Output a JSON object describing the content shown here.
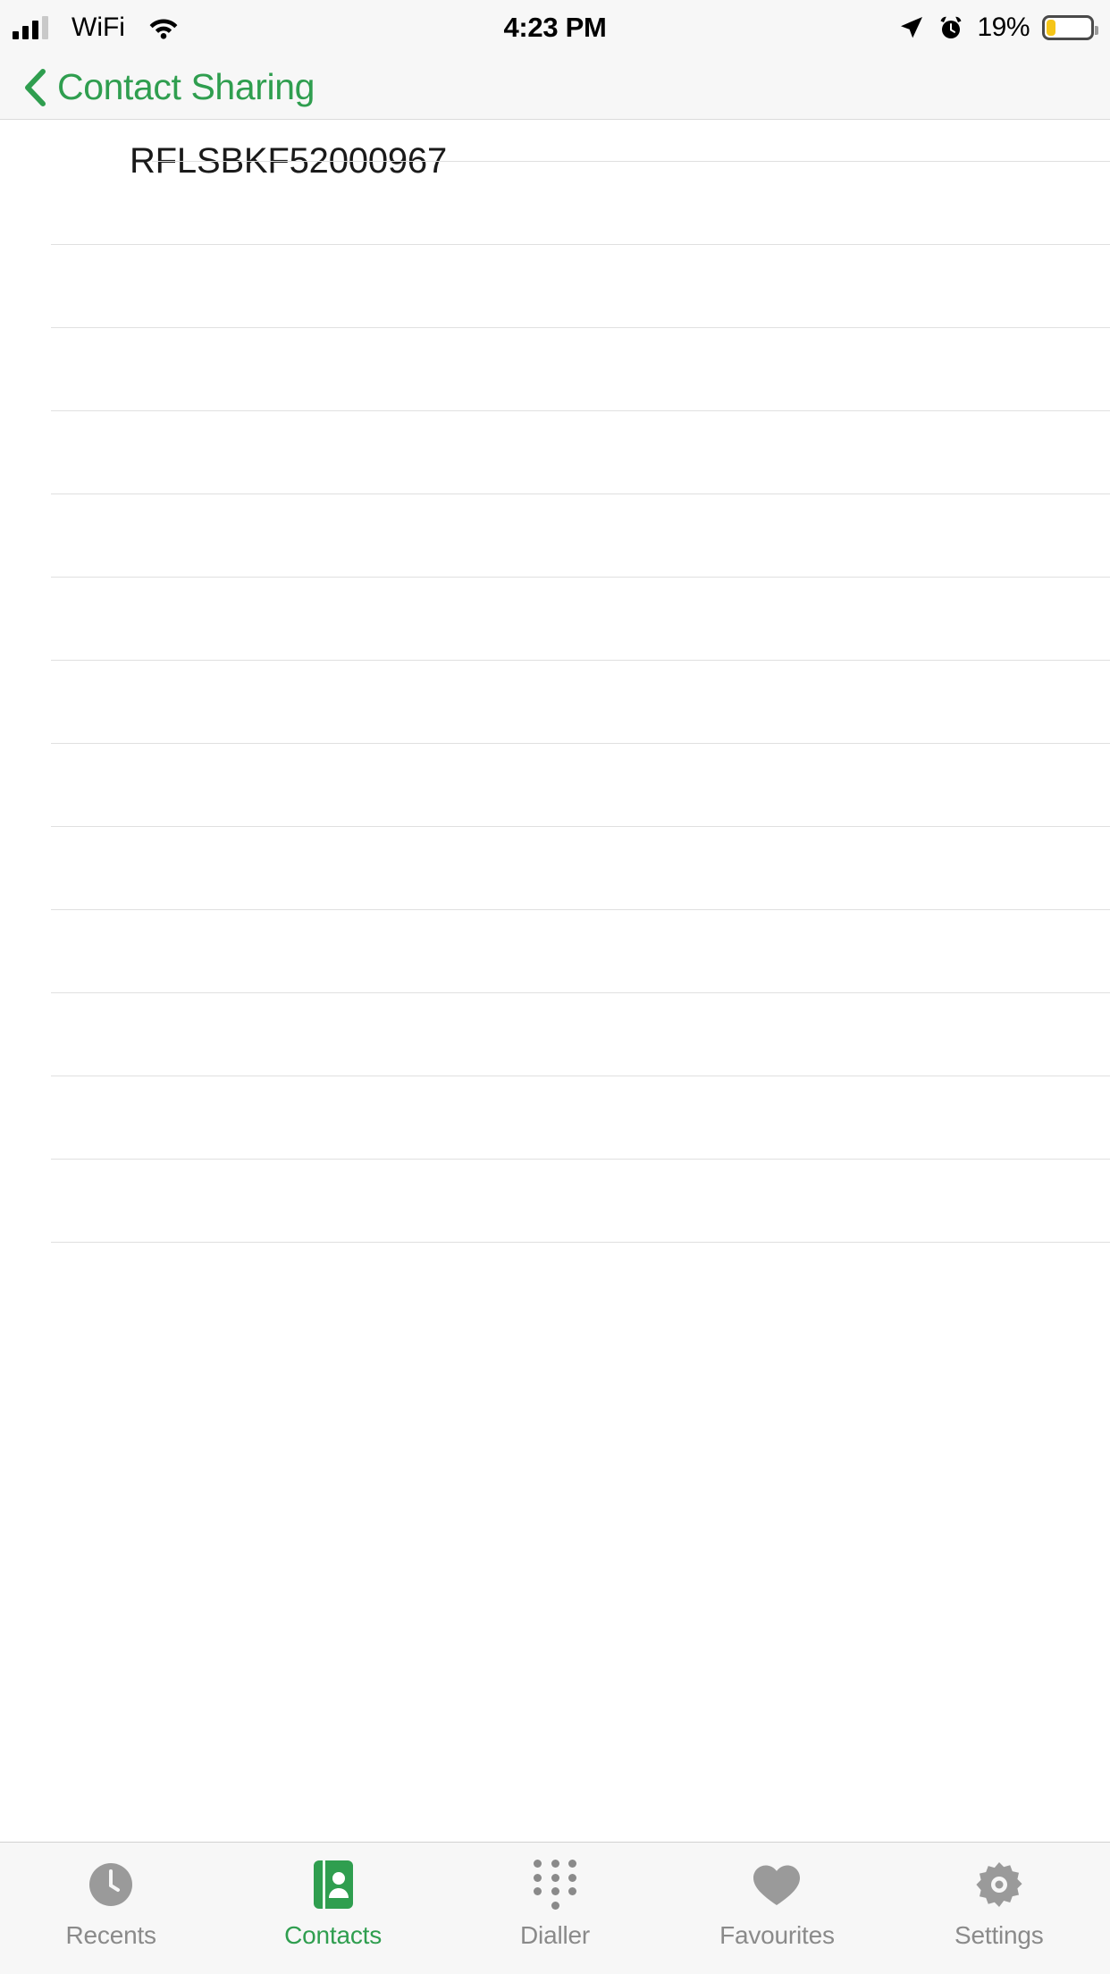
{
  "status_bar": {
    "signal_icon": "cellular-bars-icon",
    "signal_bars_filled": 3,
    "signal_bars_total": 4,
    "carrier": "WiFi",
    "wifi_icon": "wifi-icon",
    "time": "4:23 PM",
    "location_icon": "location-arrow-icon",
    "alarm_icon": "alarm-clock-icon",
    "battery_percent_label": "19%",
    "battery_level": 19,
    "battery_color": "#f5c518"
  },
  "nav_bar": {
    "back_icon": "chevron-left-icon",
    "back_title": "Contact Sharing",
    "tint_color": "#2f9e4f"
  },
  "list": {
    "rows": [
      {
        "icon": "monitor-icon",
        "label": "RFLSBKF52000967"
      }
    ],
    "empty_row_count": 12,
    "separator_color": "#e0e0e0"
  },
  "tab_bar": {
    "active_index": 1,
    "active_color": "#2f9e4f",
    "inactive_color": "#8a8a8a",
    "tabs": [
      {
        "label": "Recents",
        "icon": "clock-icon"
      },
      {
        "label": "Contacts",
        "icon": "contacts-book-icon"
      },
      {
        "label": "Dialler",
        "icon": "keypad-icon"
      },
      {
        "label": "Favourites",
        "icon": "heart-icon"
      },
      {
        "label": "Settings",
        "icon": "gear-icon"
      }
    ]
  }
}
